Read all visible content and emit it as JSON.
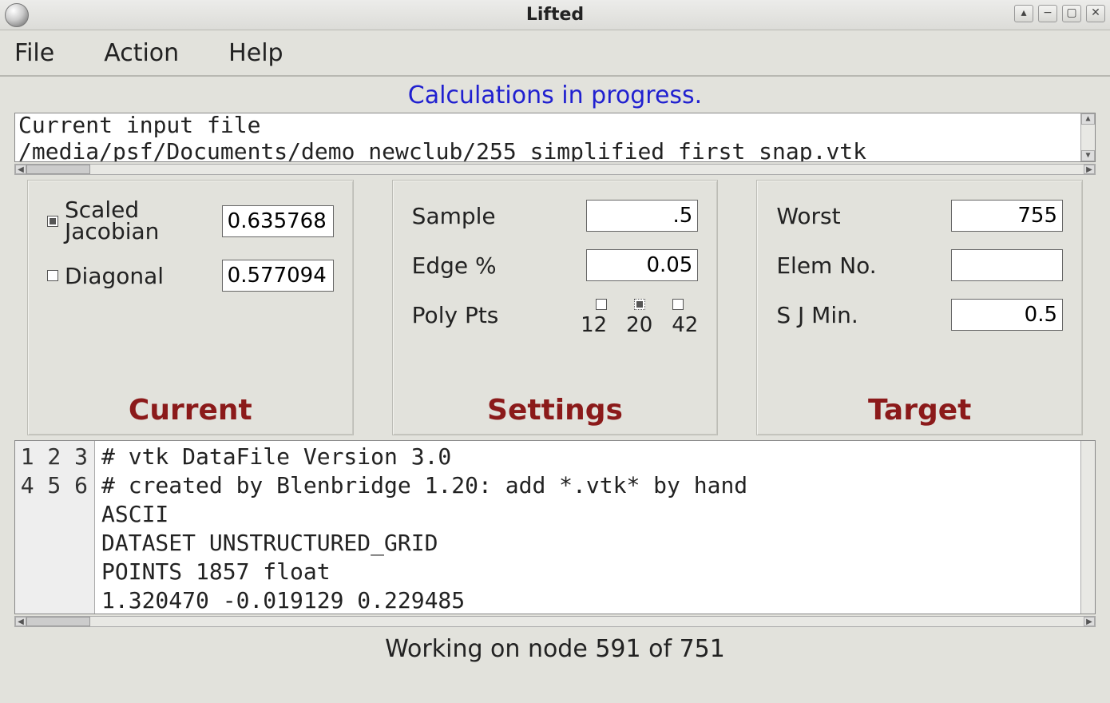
{
  "window": {
    "title": "Lifted"
  },
  "menubar": {
    "file": "File",
    "action": "Action",
    "help": "Help"
  },
  "banner": "Calculations in progress.",
  "input_file": {
    "line1": "Current input file",
    "line2": "/media/psf/Documents/demo_newclub/255_simplified_first_snap.vtk"
  },
  "panels": {
    "current": {
      "title": "Current",
      "scaled_jacobian_label_l1": "Scaled",
      "scaled_jacobian_label_l2": "Jacobian",
      "scaled_jacobian_value": "0.635768",
      "scaled_jacobian_checked": true,
      "diagonal_label": "Diagonal",
      "diagonal_value": "0.577094",
      "diagonal_checked": false
    },
    "settings": {
      "title": "Settings",
      "sample_label": "Sample",
      "sample_value": ".5",
      "edge_label": "Edge %",
      "edge_value": "0.05",
      "polypts_label": "Poly Pts",
      "polypts": {
        "opt12": {
          "label": "12",
          "checked": false
        },
        "opt20": {
          "label": "20",
          "checked": true
        },
        "opt42": {
          "label": "42",
          "checked": false
        }
      }
    },
    "target": {
      "title": "Target",
      "worst_label": "Worst",
      "worst_value": "755",
      "elemno_label": "Elem No.",
      "elemno_value": "",
      "sjmin_label": "S J Min.",
      "sjmin_value": "0.5"
    }
  },
  "code": {
    "lines": [
      "# vtk DataFile Version 3.0",
      "# created by Blenbridge 1.20: add *.vtk* by hand",
      "ASCII",
      "DATASET UNSTRUCTURED_GRID",
      "POINTS 1857 float",
      "1.320470 -0.019129 0.229485"
    ],
    "numbers": [
      "1",
      "2",
      "3",
      "4",
      "5",
      "6"
    ]
  },
  "statusbar": "Working on node 591 of 751"
}
